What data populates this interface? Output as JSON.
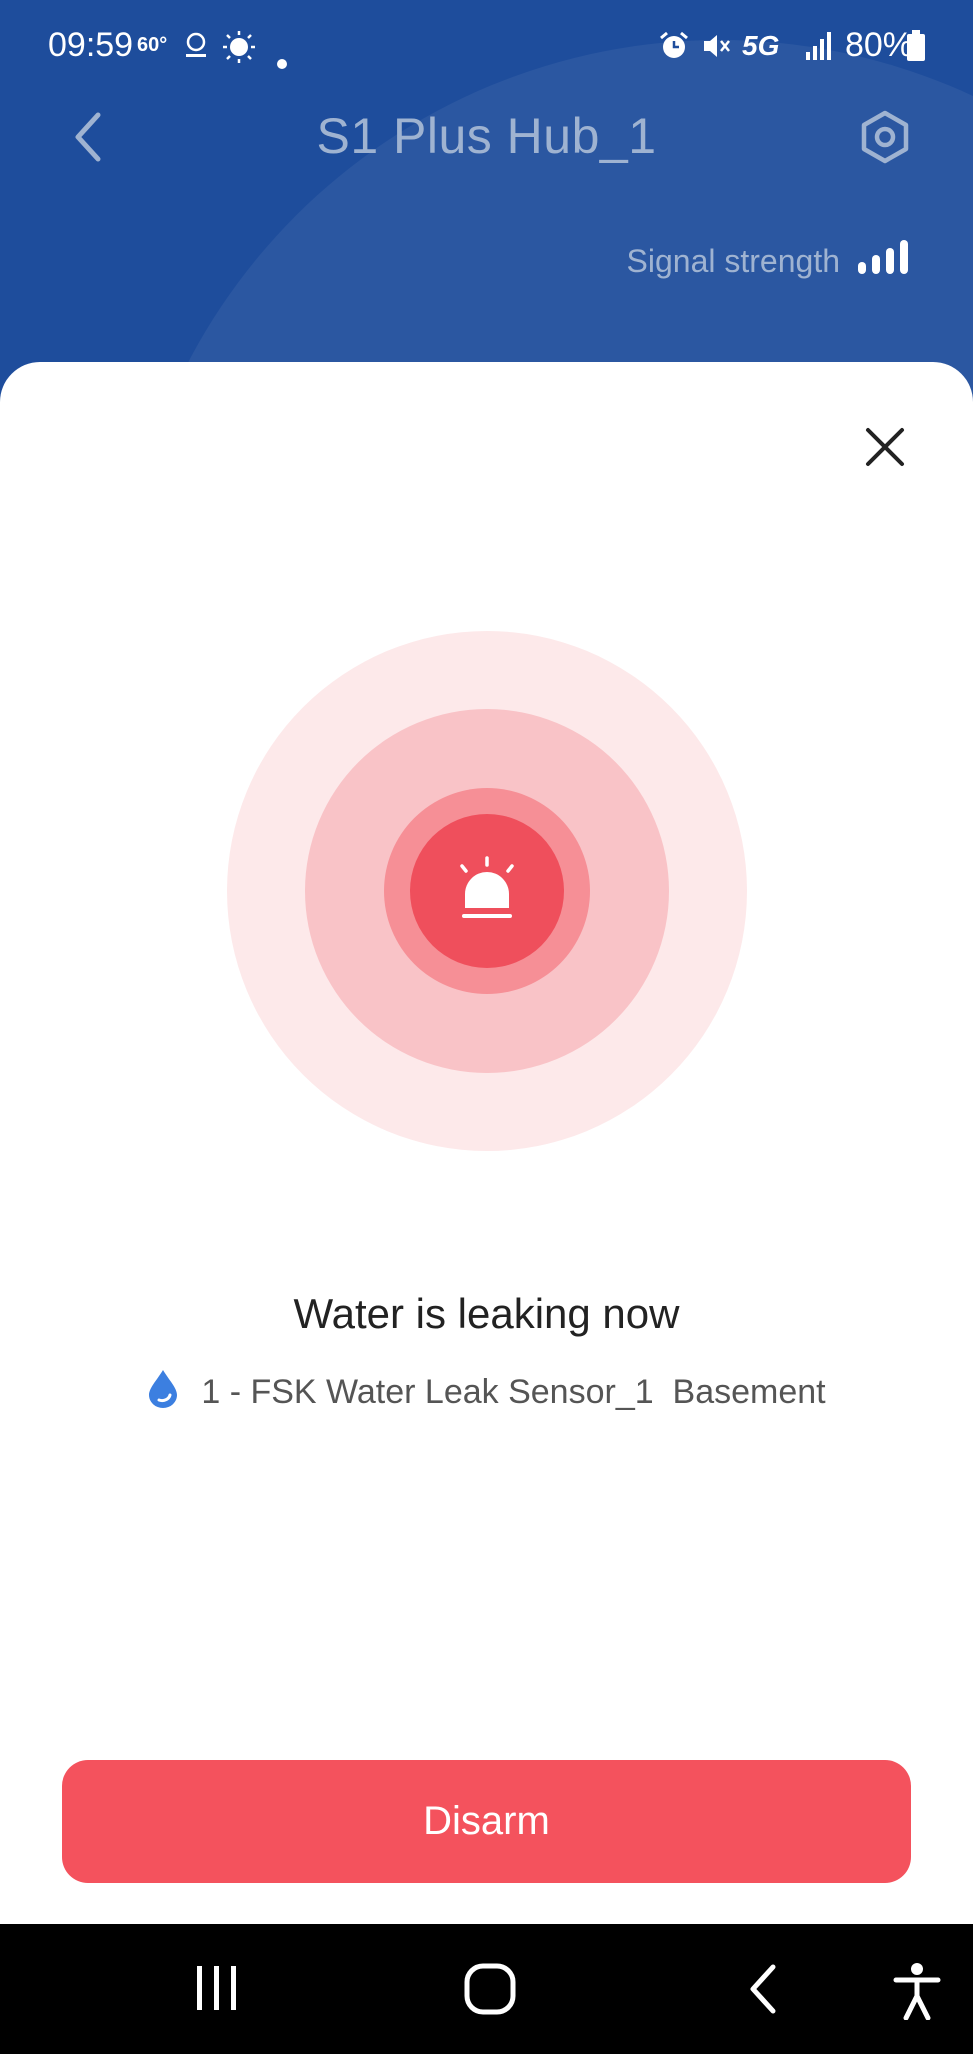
{
  "status_bar": {
    "time": "09:59",
    "temperature": "60°",
    "network": "5G",
    "battery": "80%"
  },
  "header": {
    "title": "S1 Plus Hub_1",
    "signal_label": "Signal strength"
  },
  "alert": {
    "message": "Water is leaking now",
    "sensor_label": "1 - FSK Water Leak Sensor_1  Basement"
  },
  "actions": {
    "disarm_label": "Disarm"
  },
  "colors": {
    "header_blue": "#1e4d9c",
    "alert_red": "#ef4f5c",
    "button_red": "#f4525d",
    "water_icon_blue": "#3c7fe0"
  },
  "icons": [
    "back-arrow-icon",
    "gear-icon",
    "signal-bars-icon",
    "close-icon",
    "alarm-siren-icon",
    "water-drop-icon",
    "recent-apps-icon",
    "home-icon",
    "nav-back-icon",
    "accessibility-icon"
  ]
}
